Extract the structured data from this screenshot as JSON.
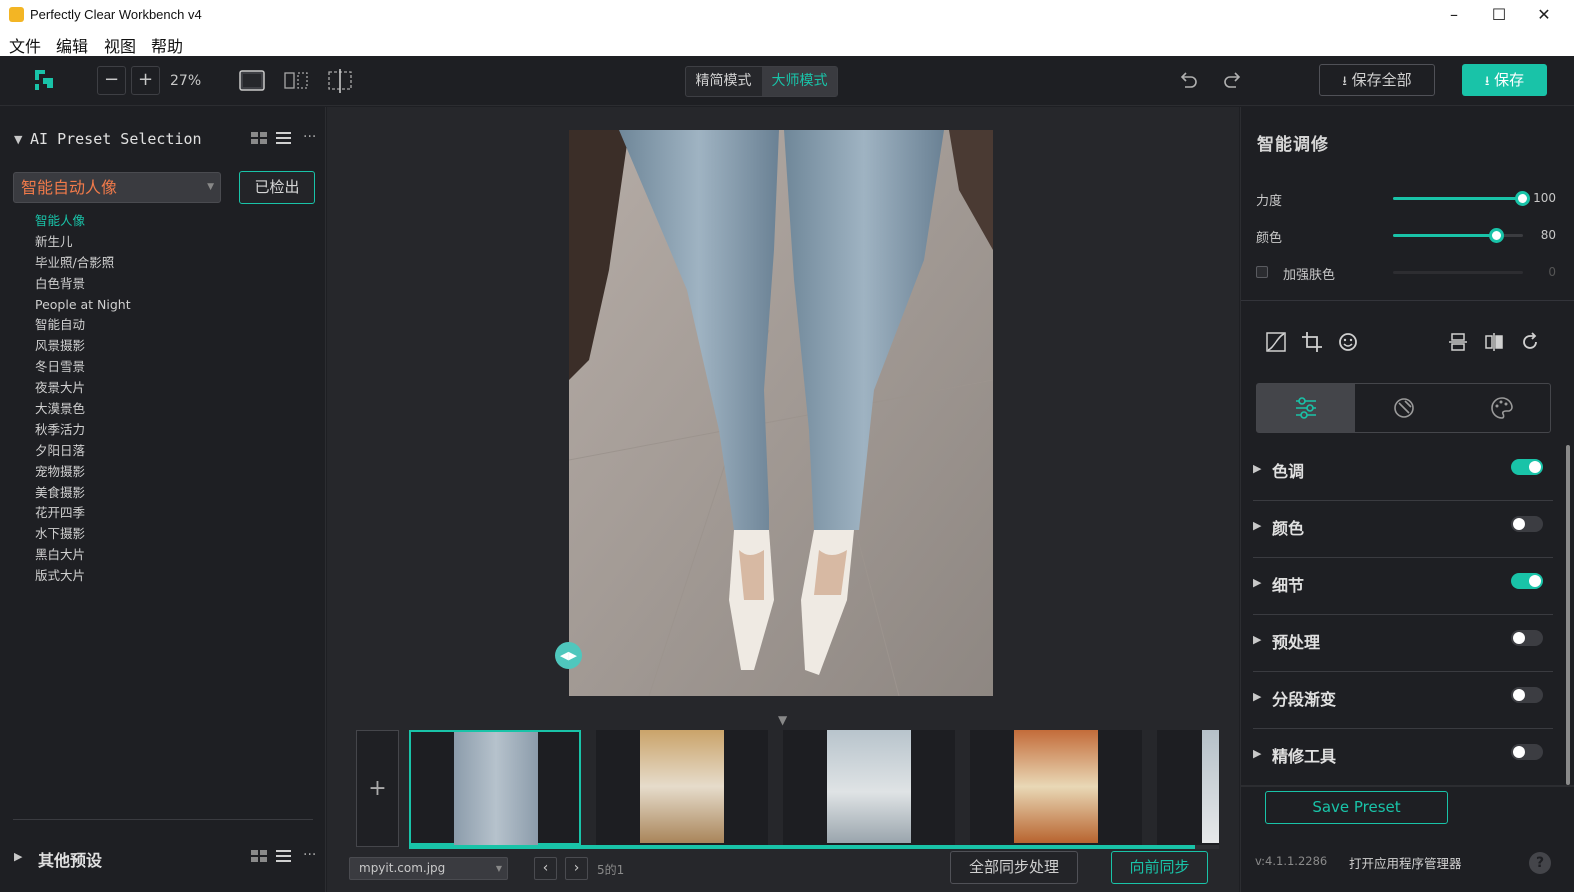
{
  "window": {
    "title": "Perfectly Clear Workbench v4",
    "minimize": "–",
    "maximize": "☐",
    "close": "✕"
  },
  "menu": {
    "file": "文件",
    "edit": "编辑",
    "view": "视图",
    "help": "帮助"
  },
  "toolbar": {
    "zoom_out": "−",
    "zoom_in": "+",
    "zoom_level": "27%",
    "mode_simple": "精简模式",
    "mode_master": "大师模式",
    "save_all": "保存全部",
    "save": "保存"
  },
  "left_panel": {
    "section_title": "AI Preset Selection",
    "selected_preset": "智能自动人像",
    "detected_button": "已检出",
    "presets": [
      "智能人像",
      "新生儿",
      "毕业照/合影照",
      "白色背景",
      "People at Night",
      "智能自动",
      "风景摄影",
      "冬日雪景",
      "夜景大片",
      "大漠景色",
      "秋季活力",
      "夕阳日落",
      "宠物摄影",
      "美食摄影",
      "花开四季",
      "水下摄影",
      "黑白大片",
      "版式大片"
    ],
    "active_preset_index": 0,
    "other_presets_title": "其他预设"
  },
  "center": {
    "add_image": "+",
    "file_name": "mpyit.com.jpg",
    "prev": "‹",
    "next": "›",
    "page_count": "5的1",
    "sync_all": "全部同步处理",
    "sync_forward": "向前同步",
    "progress": 0.97
  },
  "right_panel": {
    "title": "智能调修",
    "sliders": [
      {
        "label": "力度",
        "value": "100",
        "fraction": 1.0
      },
      {
        "label": "颜色",
        "value": "80",
        "fraction": 0.8
      },
      {
        "label": "加强肤色",
        "value": "0",
        "fraction": 0
      }
    ],
    "sections": [
      {
        "label": "色调",
        "enabled": true
      },
      {
        "label": "颜色",
        "enabled": false
      },
      {
        "label": "细节",
        "enabled": true
      },
      {
        "label": "预处理",
        "enabled": false
      },
      {
        "label": "分段渐变",
        "enabled": false
      },
      {
        "label": "精修工具",
        "enabled": false
      }
    ],
    "save_preset": "Save Preset",
    "version": "v:4.1.1.2286",
    "open_manager": "打开应用程序管理器",
    "help": "?"
  },
  "colors": {
    "accent": "#19c3a8",
    "preset_highlight": "#f07a4a",
    "background": "#1e1f23"
  }
}
